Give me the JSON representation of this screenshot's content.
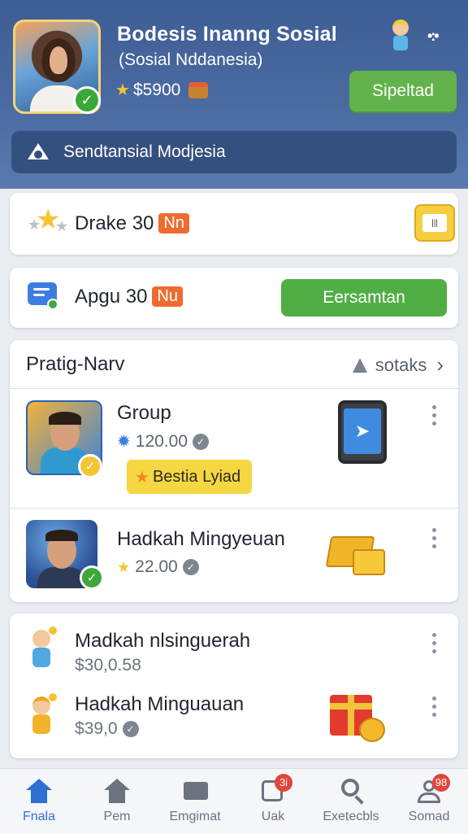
{
  "header": {
    "title": "Bodesis Inanng Sosial",
    "subtitle": "(Sosial Nddanesia)",
    "balance": "$5900",
    "primary_button": "Sipeltad"
  },
  "notice": {
    "text": "Sendtansial Modjesia"
  },
  "reward_rows": [
    {
      "label": "Drake 30",
      "tag": "Nn"
    },
    {
      "label": "Apgu 30",
      "tag": "Nu",
      "button": "Eersamtan"
    }
  ],
  "list": {
    "title": "Pratig-Narv",
    "link": "sotaks",
    "items": [
      {
        "name": "Group",
        "price": "120.00",
        "chip": "Bestia Lyiad"
      },
      {
        "name": "Hadkah Mingyeuan",
        "price": "22.00"
      }
    ]
  },
  "list2": {
    "items": [
      {
        "name": "Madkah nlsinguerah",
        "price": "$30,0.58"
      },
      {
        "name": "Hadkah Minguauan",
        "price": "$39,0"
      }
    ]
  },
  "bottom_nav": [
    {
      "label": "Fnala",
      "icon": "home-icon",
      "active": true
    },
    {
      "label": "Pem",
      "icon": "home-icon"
    },
    {
      "label": "Emgimat",
      "icon": "mail-icon"
    },
    {
      "label": "Uak",
      "icon": "box-icon",
      "badge": "3i"
    },
    {
      "label": "Exetecbls",
      "icon": "search-icon"
    },
    {
      "label": "Somad",
      "icon": "user-icon",
      "badge": "98"
    }
  ],
  "colors": {
    "header": "#3d5d94",
    "accent_green": "#4faf45",
    "tag_orange": "#f06b32",
    "chip_yellow": "#f6d641",
    "nav_active": "#2f6fd1"
  }
}
